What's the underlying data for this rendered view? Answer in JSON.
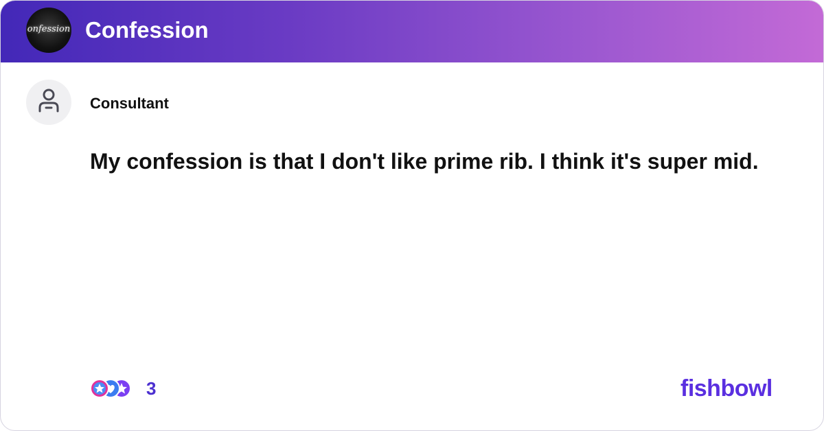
{
  "header": {
    "group_name": "Confession",
    "group_avatar_text": "onfession",
    "gradient_start": "#4328b8",
    "gradient_end": "#c36ad6"
  },
  "post": {
    "author": "Consultant",
    "author_avatar_icon": "person-icon",
    "text": "My confession is that I don't like prime rib. I think it's super mid."
  },
  "reactions": {
    "count": "3",
    "icons": [
      "star-reaction-icon",
      "heart-reaction-icon",
      "star-reaction-icon"
    ]
  },
  "brand": {
    "name": "fishbowl",
    "color": "#5a2fe0"
  }
}
